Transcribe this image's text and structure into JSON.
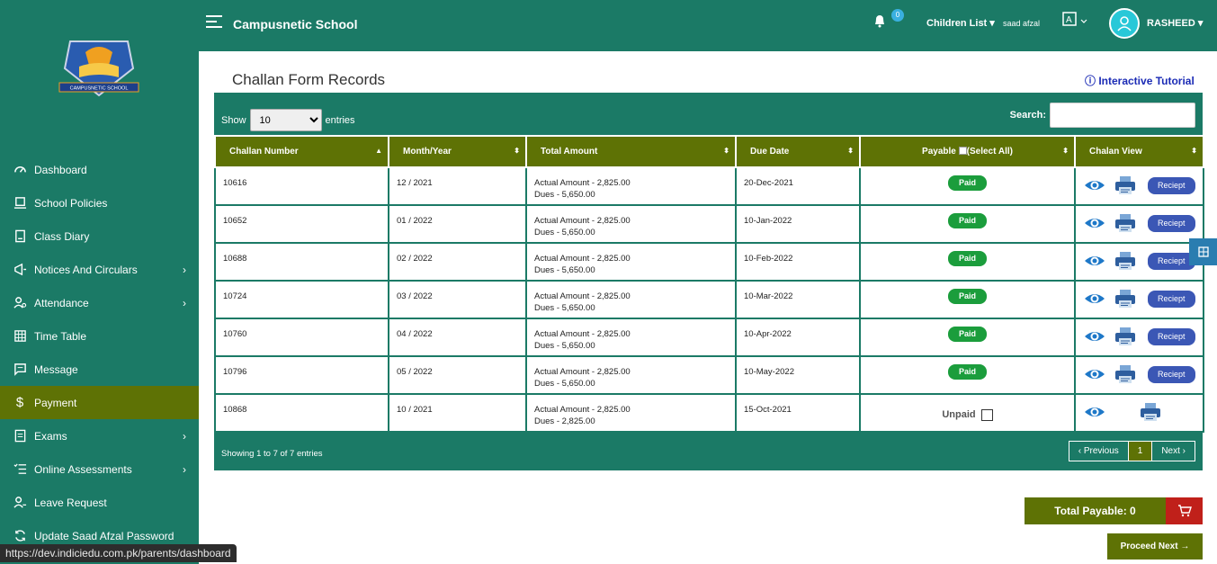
{
  "header": {
    "school_name": "Campusnetic School",
    "bell_count": "0",
    "children_label": "Children List",
    "child_name": "saad afzal",
    "user_name": "RASHEED"
  },
  "logo": {
    "text": "CAMPUSNETIC SCHOOL"
  },
  "sidebar": {
    "items": [
      {
        "label": "Dashboard",
        "icon": "dashboard-icon"
      },
      {
        "label": "School Policies",
        "icon": "policies-icon"
      },
      {
        "label": "Class Diary",
        "icon": "diary-icon"
      },
      {
        "label": "Notices And Circulars",
        "icon": "megaphone-icon",
        "chevron": "›"
      },
      {
        "label": "Attendance",
        "icon": "attendance-icon",
        "chevron": "›"
      },
      {
        "label": "Time Table",
        "icon": "grid-icon"
      },
      {
        "label": "Message",
        "icon": "message-icon"
      },
      {
        "label": "Payment",
        "icon": "dollar-icon"
      },
      {
        "label": "Exams",
        "icon": "exams-icon",
        "chevron": "›"
      },
      {
        "label": "Online Assessments",
        "icon": "checklist-icon",
        "chevron": "›"
      },
      {
        "label": "Leave Request",
        "icon": "leave-icon"
      },
      {
        "label": "Update Saad Afzal Password",
        "icon": "refresh-icon"
      }
    ]
  },
  "page": {
    "title": "Challan Form Records",
    "tutorial": "ⓘ Interactive Tutorial",
    "show_label": "Show",
    "entries_label": "entries",
    "page_size": "10",
    "search_label": "Search:"
  },
  "table": {
    "headers": [
      "Challan Number",
      "Month/Year",
      "Total Amount",
      "Due Date",
      "Payable",
      "(Select All)",
      "Chalan View"
    ],
    "rows": [
      {
        "number": "10616",
        "month": "12 / 2021",
        "actual": "Actual Amount - 2,825.00",
        "dues": "Dues - 5,650.00",
        "due": "20-Dec-2021",
        "status": "Paid",
        "receipt": "Reciept"
      },
      {
        "number": "10652",
        "month": "01 / 2022",
        "actual": "Actual Amount - 2,825.00",
        "dues": "Dues - 5,650.00",
        "due": "10-Jan-2022",
        "status": "Paid",
        "receipt": "Reciept"
      },
      {
        "number": "10688",
        "month": "02 / 2022",
        "actual": "Actual Amount - 2,825.00",
        "dues": "Dues - 5,650.00",
        "due": "10-Feb-2022",
        "status": "Paid",
        "receipt": "Reciept"
      },
      {
        "number": "10724",
        "month": "03 / 2022",
        "actual": "Actual Amount - 2,825.00",
        "dues": "Dues - 5,650.00",
        "due": "10-Mar-2022",
        "status": "Paid",
        "receipt": "Reciept"
      },
      {
        "number": "10760",
        "month": "04 / 2022",
        "actual": "Actual Amount - 2,825.00",
        "dues": "Dues - 5,650.00",
        "due": "10-Apr-2022",
        "status": "Paid",
        "receipt": "Reciept"
      },
      {
        "number": "10796",
        "month": "05 / 2022",
        "actual": "Actual Amount - 2,825.00",
        "dues": "Dues - 5,650.00",
        "due": "10-May-2022",
        "status": "Paid",
        "receipt": "Reciept"
      },
      {
        "number": "10868",
        "month": "10 / 2021",
        "actual": "Actual Amount - 2,825.00",
        "dues": "Dues - 2,825.00",
        "due": "15-Oct-2021",
        "status": "Unpaid",
        "receipt": ""
      }
    ]
  },
  "footer": {
    "showing": "Showing 1 to 7 of 7 entries",
    "previous": "‹  Previous",
    "page": "1",
    "next": "Next  ›"
  },
  "totals": {
    "total_payable": "Total Payable: 0",
    "proceed": "Proceed Next →"
  },
  "status_url": "https://dev.indiciedu.com.pk/parents/dashboard",
  "colors": {
    "primary": "#1b7a66",
    "accent": "#5e7205",
    "paid": "#1b9d3c",
    "reciept": "#3b57b5",
    "cart": "#c0201a"
  }
}
